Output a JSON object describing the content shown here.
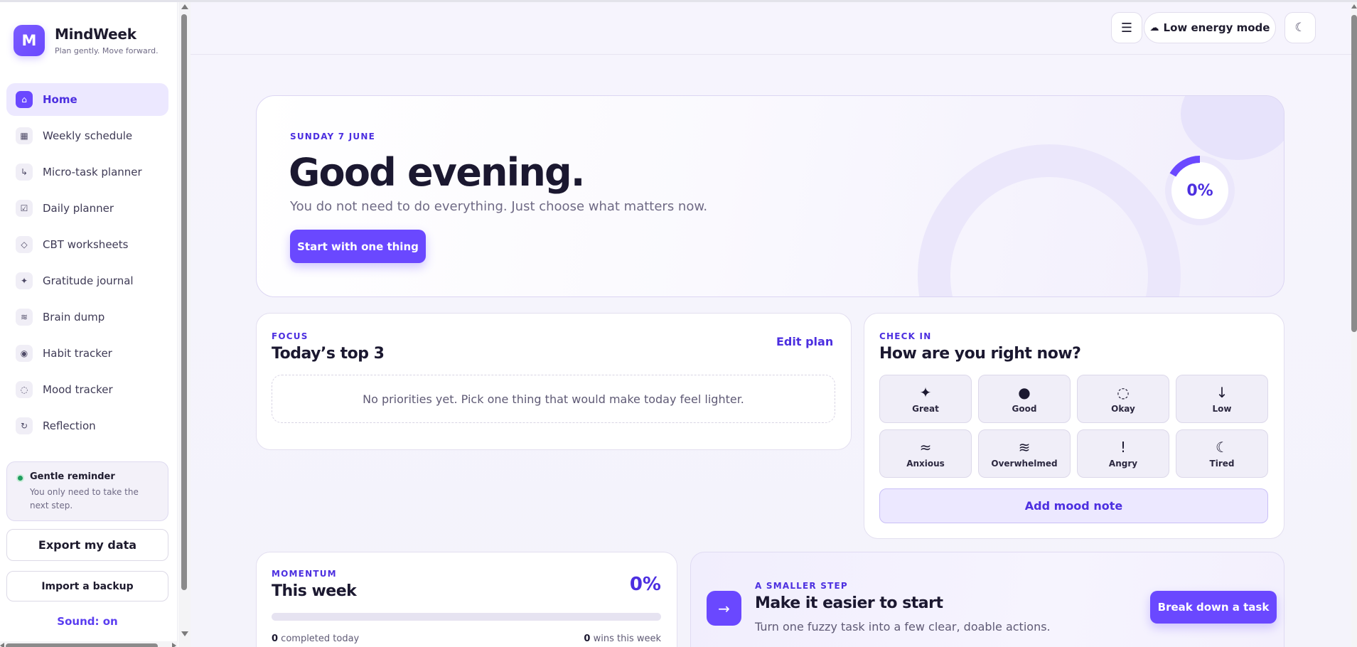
{
  "brand": {
    "logo_letter": "M",
    "name": "MindWeek",
    "tagline": "Plan gently. Move forward."
  },
  "nav": {
    "items": [
      {
        "label": "Home",
        "icon": "home-icon",
        "glyph": "⌂",
        "active": true
      },
      {
        "label": "Weekly schedule",
        "icon": "calendar-grid-icon",
        "glyph": "▦"
      },
      {
        "label": "Micro-task planner",
        "icon": "subtask-arrow-icon",
        "glyph": "↳"
      },
      {
        "label": "Daily planner",
        "icon": "checkbox-icon",
        "glyph": "☑"
      },
      {
        "label": "CBT worksheets",
        "icon": "diamond-icon",
        "glyph": "◇"
      },
      {
        "label": "Gratitude journal",
        "icon": "sparkle-icon",
        "glyph": "✦"
      },
      {
        "label": "Brain dump",
        "icon": "waves-icon",
        "glyph": "≋"
      },
      {
        "label": "Habit tracker",
        "icon": "target-icon",
        "glyph": "◉"
      },
      {
        "label": "Mood tracker",
        "icon": "circle-outline-icon",
        "glyph": "◌"
      },
      {
        "label": "Reflection",
        "icon": "refresh-icon",
        "glyph": "↻"
      }
    ]
  },
  "reminder": {
    "title": "Gentle reminder",
    "body": "You only need to take the next step."
  },
  "sidebar_actions": {
    "export_label": "Export my data",
    "import_label": "Import a backup",
    "sound_label": "Sound: on"
  },
  "topbar": {
    "menu_glyph": "☰",
    "energy_icon": "☁",
    "energy_label": "Low energy mode",
    "theme_glyph": "☾"
  },
  "hero": {
    "date": "SUNDAY 7 JUNE",
    "title": "Good evening.",
    "subtitle": "You do not need to do everything. Just choose what matters now.",
    "cta": "Start with one thing",
    "progress_label": "0%",
    "progress_value": 0
  },
  "focus": {
    "kicker": "FOCUS",
    "title": "Today’s top 3",
    "edit_label": "Edit plan",
    "empty_text": "No priorities yet. Pick one thing that would make today feel lighter."
  },
  "checkin": {
    "kicker": "CHECK IN",
    "title": "How are you right now?",
    "moods": [
      {
        "glyph": "✦",
        "label": "Great"
      },
      {
        "glyph": "●",
        "label": "Good"
      },
      {
        "glyph": "◌",
        "label": "Okay"
      },
      {
        "glyph": "↓",
        "label": "Low"
      },
      {
        "glyph": "≈",
        "label": "Anxious"
      },
      {
        "glyph": "≋",
        "label": "Overwhelmed"
      },
      {
        "glyph": "!",
        "label": "Angry"
      },
      {
        "glyph": "☾",
        "label": "Tired"
      }
    ],
    "add_note_label": "Add mood note"
  },
  "momentum": {
    "kicker": "MOMENTUM",
    "title": "This week",
    "percent_label": "0%",
    "progress_value": 0,
    "completed_count": "0",
    "completed_text": " completed today",
    "wins_count": "0",
    "wins_text": " wins this week"
  },
  "smaller_step": {
    "icon_glyph": "→",
    "kicker": "A SMALLER STEP",
    "title": "Make it easier to start",
    "subtitle": "Turn one fuzzy task into a few clear, doable actions.",
    "cta": "Break down a task"
  },
  "colors": {
    "accent": "#6a48ff",
    "accent_text": "#4c2fe0",
    "active_nav_bg": "#ece8ff",
    "reminder_dot": "#1f9d5f",
    "page_bg": "#f6f4fd"
  }
}
